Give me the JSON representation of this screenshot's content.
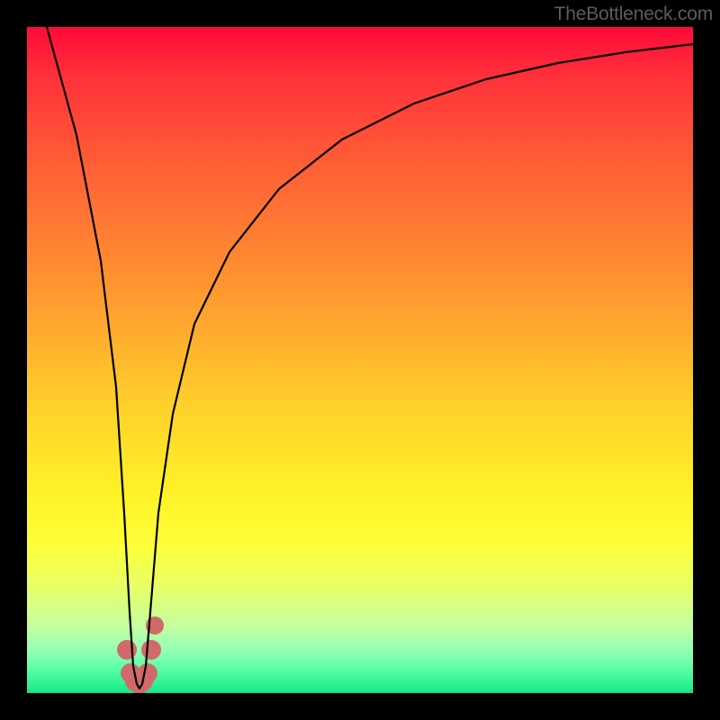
{
  "watermark": "TheBottleneck.com",
  "chart_data": {
    "type": "line",
    "title": "",
    "xlabel": "",
    "ylabel": "",
    "xlim": [
      0,
      100
    ],
    "ylim": [
      0,
      100
    ],
    "grid": false,
    "legend": false,
    "background": "vertical red→yellow→green gradient",
    "series": [
      {
        "name": "bottleneck-curve",
        "x": [
          0,
          4,
          8,
          12,
          14.5,
          15.6,
          16.3,
          16.8,
          17.4,
          18.0,
          18.6,
          19.3,
          20.2,
          21.5,
          23.5,
          26,
          30,
          35,
          41,
          48,
          56,
          66,
          78,
          90,
          100
        ],
        "y": [
          100,
          82.5,
          65,
          47.5,
          28,
          14,
          6,
          3,
          2,
          3,
          6,
          14,
          28,
          42,
          56,
          65,
          73,
          79,
          83.5,
          87,
          90,
          92.5,
          94.5,
          96,
          97
        ],
        "stroke": "#000000",
        "stroke_width": 2
      },
      {
        "name": "optimal-marker",
        "type": "scatter",
        "x": [
          15.0,
          15.6,
          16.3,
          17.4,
          18.0,
          18.6,
          19.2,
          16.8
        ],
        "y": [
          6.5,
          3.0,
          1.8,
          1.8,
          3.0,
          6.5,
          10.0,
          1.4
        ],
        "marker_color": "#d36b6b",
        "marker_size": 12
      }
    ],
    "notes": "Axes are unlabeled in the source image; values are estimated on a 0–100 normalized scale from the plot geometry. The black curve drops sharply from top-left to a cusp-like minimum near x≈17 and then rises with diminishing slope toward the upper right. A cluster of dull-red blobs sits at the curve's minimum."
  }
}
